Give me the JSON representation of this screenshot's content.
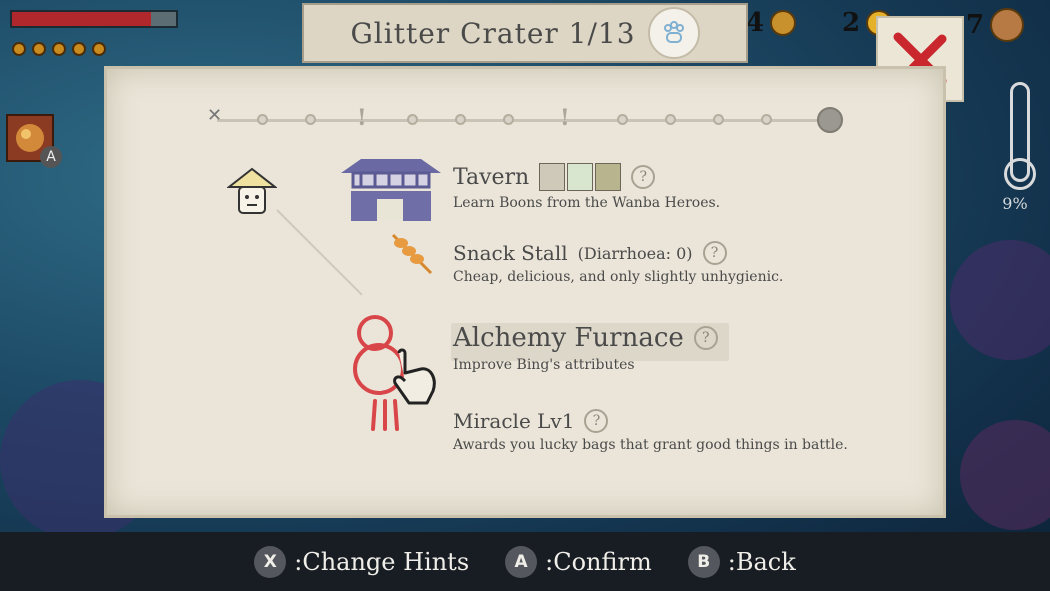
{
  "hud": {
    "health_fraction": 0.85,
    "pips": 5,
    "skill_key": "A",
    "counters": [
      {
        "value": "4",
        "icon": "coin-icon"
      },
      {
        "value": "2",
        "icon": "gold-coin-icon"
      },
      {
        "value": "7",
        "icon": "copper-coin-icon"
      }
    ],
    "percent": "9%"
  },
  "header": {
    "title": "Glitter Crater 1/13",
    "icon": "paw-icon"
  },
  "options": [
    {
      "name": "Tavern",
      "description": "Learn Boons from the Wanba Heroes.",
      "icon": "tavern-building-icon"
    },
    {
      "name": "Snack Stall",
      "extra": "(Diarrhoea: 0)",
      "description": "Cheap, delicious, and only slightly unhygienic.",
      "icon": "skewer-icon"
    },
    {
      "name": "Alchemy Furnace",
      "description": "Improve Bing's attributes",
      "icon": "gourd-icon"
    },
    {
      "name": "Miracle Lv1",
      "description": "Awards you lucky bags that grant good things in battle.",
      "icon": "miracle-icon"
    }
  ],
  "help_glyph": "?",
  "bottom_hints": [
    {
      "key": "X",
      "label": ":Change Hints"
    },
    {
      "key": "A",
      "label": ":Confirm"
    },
    {
      "key": "B",
      "label": ":Back"
    }
  ],
  "colors": {
    "accent_red": "#c9272d",
    "panel": "#eae5d8",
    "building_blue": "#5b5a93"
  }
}
